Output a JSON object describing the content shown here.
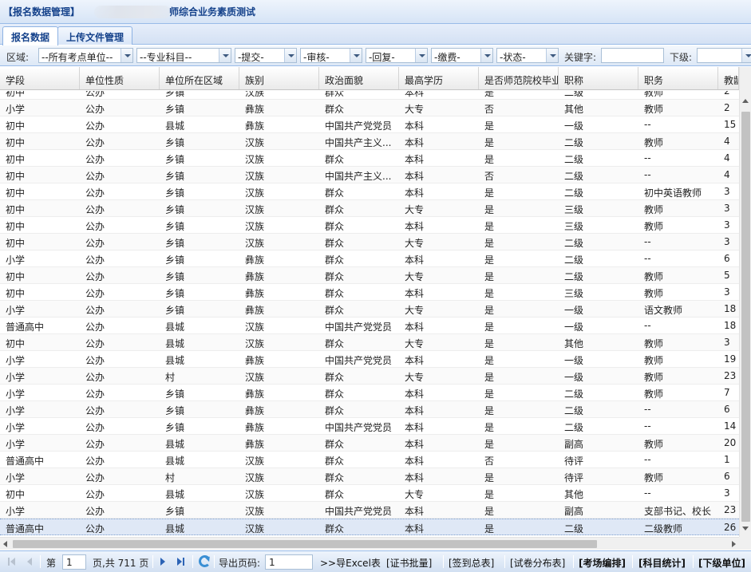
{
  "window": {
    "title_part1": "【报名数据管理】",
    "title_part2": "师综合业务素质测试"
  },
  "tabs": [
    {
      "label": "报名数据",
      "active": true
    },
    {
      "label": "上传文件管理",
      "active": false
    }
  ],
  "filters": {
    "region_label": "区域:",
    "region_value": "--所有考点单位--",
    "subject_value": "--专业科目--",
    "submit_value": "-提交-",
    "review_value": "-审核-",
    "reply_value": "-回复-",
    "payment_value": "-缴费-",
    "status_value": "-状态-",
    "keyword_label": "关键字:",
    "keyword_value": "",
    "sub_label": "下级:",
    "sub_value": ""
  },
  "grid": {
    "columns": [
      "学段",
      "单位性质",
      "单位所在区域",
      "族别",
      "政治面貌",
      "最高学历",
      "是否师范院校毕业",
      "职称",
      "职务",
      "教龄"
    ],
    "rows": [
      [
        "初中",
        "公办",
        "乡镇",
        "汉族",
        "群众",
        "本科",
        "是",
        "二级",
        "教师",
        "2"
      ],
      [
        "小学",
        "公办",
        "乡镇",
        "彝族",
        "群众",
        "大专",
        "否",
        "其他",
        "教师",
        "2"
      ],
      [
        "初中",
        "公办",
        "县城",
        "彝族",
        "中国共产党党员",
        "本科",
        "是",
        "一级",
        "--",
        "15"
      ],
      [
        "初中",
        "公办",
        "乡镇",
        "汉族",
        "中国共产主义...",
        "本科",
        "是",
        "二级",
        "教师",
        "4"
      ],
      [
        "初中",
        "公办",
        "乡镇",
        "汉族",
        "群众",
        "本科",
        "是",
        "二级",
        "--",
        "4"
      ],
      [
        "初中",
        "公办",
        "乡镇",
        "汉族",
        "中国共产主义...",
        "本科",
        "否",
        "二级",
        "--",
        "4"
      ],
      [
        "初中",
        "公办",
        "乡镇",
        "汉族",
        "群众",
        "本科",
        "是",
        "二级",
        "初中英语教师",
        "3"
      ],
      [
        "初中",
        "公办",
        "乡镇",
        "汉族",
        "群众",
        "大专",
        "是",
        "三级",
        "教师",
        "3"
      ],
      [
        "初中",
        "公办",
        "乡镇",
        "汉族",
        "群众",
        "本科",
        "是",
        "三级",
        "教师",
        "3"
      ],
      [
        "初中",
        "公办",
        "乡镇",
        "汉族",
        "群众",
        "大专",
        "是",
        "二级",
        "--",
        "3"
      ],
      [
        "小学",
        "公办",
        "乡镇",
        "彝族",
        "群众",
        "本科",
        "是",
        "二级",
        "--",
        "6"
      ],
      [
        "初中",
        "公办",
        "乡镇",
        "彝族",
        "群众",
        "大专",
        "是",
        "二级",
        "教师",
        "5"
      ],
      [
        "初中",
        "公办",
        "乡镇",
        "彝族",
        "群众",
        "本科",
        "是",
        "三级",
        "教师",
        "3"
      ],
      [
        "小学",
        "公办",
        "乡镇",
        "彝族",
        "群众",
        "大专",
        "是",
        "一级",
        "语文教师",
        "18"
      ],
      [
        "普通高中",
        "公办",
        "县城",
        "汉族",
        "中国共产党党员",
        "本科",
        "是",
        "一级",
        "--",
        "18"
      ],
      [
        "初中",
        "公办",
        "县城",
        "汉族",
        "群众",
        "大专",
        "是",
        "其他",
        "教师",
        "3"
      ],
      [
        "小学",
        "公办",
        "县城",
        "彝族",
        "中国共产党党员",
        "本科",
        "是",
        "一级",
        "教师",
        "19"
      ],
      [
        "小学",
        "公办",
        "村",
        "汉族",
        "群众",
        "大专",
        "是",
        "一级",
        "教师",
        "23"
      ],
      [
        "小学",
        "公办",
        "乡镇",
        "彝族",
        "群众",
        "本科",
        "是",
        "二级",
        "教师",
        "7"
      ],
      [
        "小学",
        "公办",
        "乡镇",
        "彝族",
        "群众",
        "本科",
        "是",
        "二级",
        "--",
        "6"
      ],
      [
        "小学",
        "公办",
        "乡镇",
        "彝族",
        "中国共产党党员",
        "本科",
        "是",
        "二级",
        "--",
        "14"
      ],
      [
        "小学",
        "公办",
        "县城",
        "彝族",
        "群众",
        "本科",
        "是",
        "副高",
        "教师",
        "20"
      ],
      [
        "普通高中",
        "公办",
        "县城",
        "汉族",
        "群众",
        "本科",
        "否",
        "待评",
        "--",
        "1"
      ],
      [
        "小学",
        "公办",
        "村",
        "汉族",
        "群众",
        "本科",
        "是",
        "待评",
        "教师",
        "6"
      ],
      [
        "初中",
        "公办",
        "县城",
        "汉族",
        "群众",
        "大专",
        "是",
        "其他",
        "--",
        "3"
      ],
      [
        "小学",
        "公办",
        "乡镇",
        "汉族",
        "中国共产党党员",
        "本科",
        "是",
        "副高",
        "支部书记、校长",
        "23"
      ],
      [
        "普通高中",
        "公办",
        "县城",
        "汉族",
        "群众",
        "本科",
        "是",
        "二级",
        "二级教师",
        "26"
      ]
    ],
    "selected_row": 26
  },
  "pager": {
    "page_prefix": "第",
    "current_page": "1",
    "page_suffix": "页,共 711 页",
    "export_label": "导出页码:",
    "export_value": "1",
    "export_excel": ">>导Excel表",
    "cert_batch": "[证书批量]",
    "signin_total": "[签到总表]",
    "paper_dist": "[试卷分布表]",
    "room_arrange": "[考场编排]",
    "subject_stats": "[科目统计]",
    "sub_units": "[下级单位]"
  }
}
